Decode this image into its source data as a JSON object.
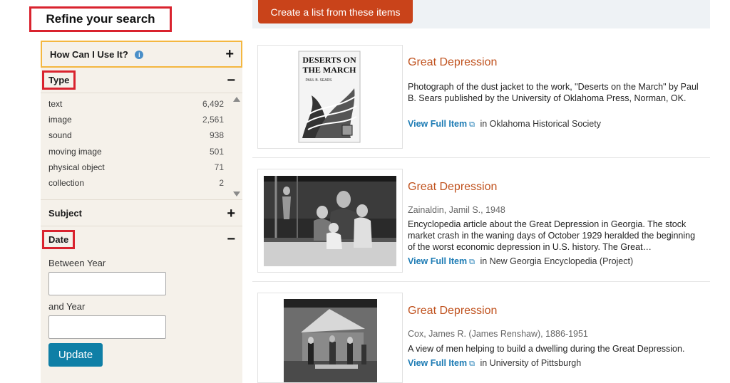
{
  "sidebar": {
    "refine_title": "Refine your search",
    "how_can": "How Can I Use It?",
    "type_label": "Type",
    "subject_label": "Subject",
    "date_label": "Date",
    "type_items": [
      {
        "label": "text",
        "count": "6,492"
      },
      {
        "label": "image",
        "count": "2,561"
      },
      {
        "label": "sound",
        "count": "938"
      },
      {
        "label": "moving image",
        "count": "501"
      },
      {
        "label": "physical object",
        "count": "71"
      },
      {
        "label": "collection",
        "count": "2"
      }
    ],
    "between_year_label": "Between Year",
    "and_year_label": "and Year",
    "update_label": "Update"
  },
  "toolbar": {
    "create_list_label": "Create a list from these items"
  },
  "results": [
    {
      "title": "Great Depression",
      "meta": "",
      "description": "Photograph of the dust jacket to the work, \"Deserts on the March\" by Paul B. Sears published by the University of Oklahoma Press, Norman, OK.",
      "view_label": "View Full Item",
      "source": "in Oklahoma Historical Society",
      "thumb_text_1": "DESERTS ON",
      "thumb_text_2": "THE MARCH",
      "thumb_text_3": "PAUL B. SEARS"
    },
    {
      "title": "Great Depression",
      "meta": "Zainaldin, Jamil S., 1948",
      "description": "Encyclopedia article about the Great Depression in Georgia. The stock market crash in the waning days of October 1929 heralded the beginning of the worst economic depression in U.S. history. The Great…",
      "view_label": "View Full Item",
      "source": "in New Georgia Encyclopedia (Project)"
    },
    {
      "title": "Great Depression",
      "meta": "Cox, James R. (James Renshaw), 1886-1951",
      "description": "A view of men helping to build a dwelling during the Great Depression.",
      "view_label": "View Full Item",
      "source": "in University of Pittsburgh"
    }
  ],
  "colors": {
    "accent": "#c9431a",
    "link": "#1c7bb4",
    "title": "#c0521e",
    "highlight_box": "#d9232e",
    "how_can_border": "#f4b740"
  }
}
